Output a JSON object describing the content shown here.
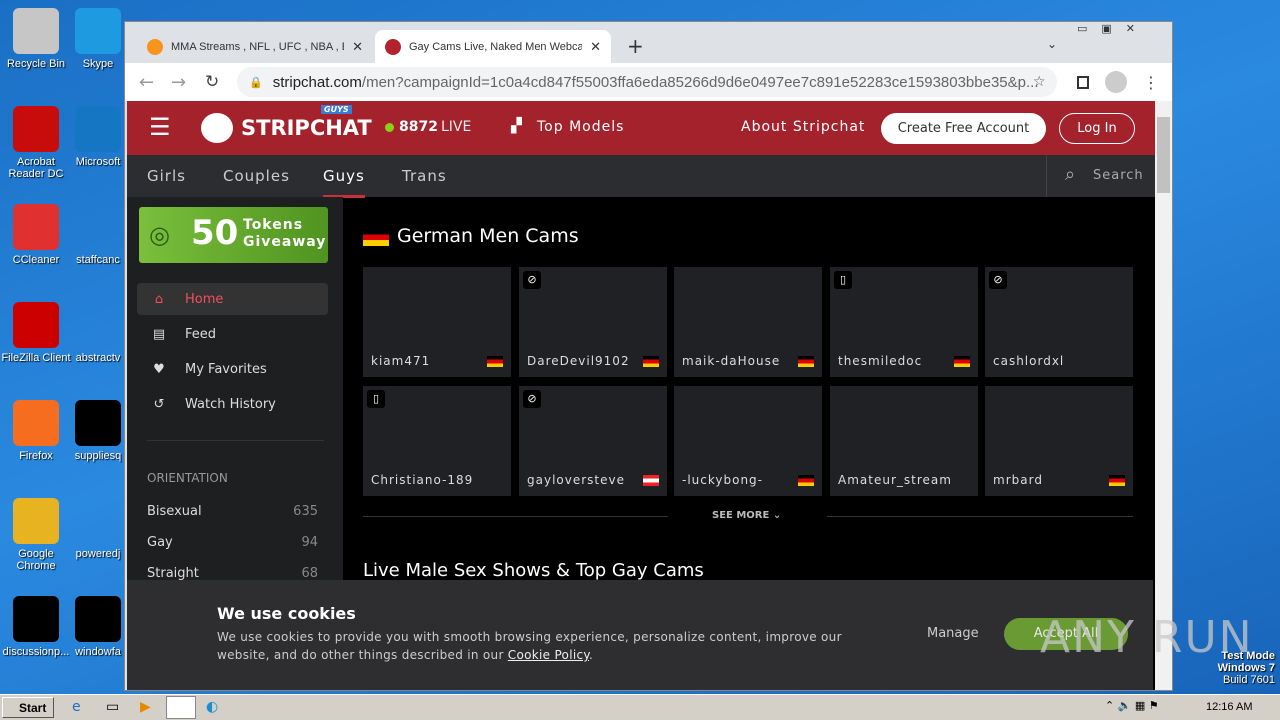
{
  "desktop": {
    "icons": [
      "Recycle Bin",
      "Skype",
      "Acrobat Reader DC",
      "Microsoft",
      "CCleaner",
      "staffcanc",
      "FileZilla Client",
      "abstractv",
      "Firefox",
      "suppliesq",
      "Google Chrome",
      "poweredj",
      "discussionp...",
      "windowfa"
    ],
    "watermark": "ANY RUN",
    "test_mode": [
      "Test Mode",
      "Windows 7",
      "Build 7601"
    ]
  },
  "browser": {
    "tabs": [
      {
        "title": "MMA Streams , NFL , UFC , NBA , Bo"
      },
      {
        "title": "Gay Cams Live, Naked Men Webcam"
      }
    ],
    "url_domain": "stripchat.com",
    "url_path": "/men?campaignId=1c0a4cd847f55003ffa6eda85266d9d6e0497ee7c891e52283ce1593803bbe35&p..."
  },
  "site": {
    "logo": "STRIPCHAT",
    "logo_badge": "GUYS",
    "live_count": "8872",
    "live_label": "LIVE",
    "top_models": "Top Models",
    "about": "About Stripchat",
    "create_account": "Create Free Account",
    "login": "Log In",
    "nav": [
      "Girls",
      "Couples",
      "Guys",
      "Trans"
    ],
    "search_placeholder": "Search",
    "promo": {
      "amount": "50",
      "line1": "Tokens",
      "line2": "Giveaway"
    },
    "sidebar": [
      {
        "label": "Home",
        "icon": "home-icon"
      },
      {
        "label": "Feed",
        "icon": "feed-icon"
      },
      {
        "label": "My Favorites",
        "icon": "heart-icon"
      },
      {
        "label": "Watch History",
        "icon": "history-icon"
      }
    ],
    "orientation_title": "ORIENTATION",
    "orientation": [
      {
        "label": "Bisexual",
        "count": "635"
      },
      {
        "label": "Gay",
        "count": "94"
      },
      {
        "label": "Straight",
        "count": "68"
      }
    ],
    "section_title": "German Men Cams",
    "cams": [
      {
        "name": "kiam471",
        "flag": "de"
      },
      {
        "name": "DareDevil9102",
        "flag": "de",
        "badge": "vr"
      },
      {
        "name": "maik-daHouse",
        "flag": "de"
      },
      {
        "name": "thesmiledoc",
        "flag": "de",
        "badge": "mobile"
      },
      {
        "name": "cashlordxl",
        "flag": "",
        "badge": "vr"
      },
      {
        "name": "Christiano-189",
        "flag": "",
        "badge": "mobile"
      },
      {
        "name": "gayloversteve",
        "flag": "at",
        "badge": "vr"
      },
      {
        "name": "-luckybong-",
        "flag": "de"
      },
      {
        "name": "Amateur_stream",
        "flag": ""
      },
      {
        "name": "mrbard",
        "flag": "de"
      }
    ],
    "see_more": "SEE MORE",
    "section2_title": "Live Male Sex Shows & Top Gay Cams",
    "cookie": {
      "title": "We use cookies",
      "text": "We use cookies to provide you with smooth browsing experience, personalize content, improve our website, and do other things described in our ",
      "link": "Cookie Policy",
      "manage": "Manage",
      "accept": "Accept All"
    }
  },
  "taskbar": {
    "start": "Start",
    "clock": "12:16 AM"
  },
  "colors": {
    "brand": "#a3222c",
    "accent_green": "#6a9a34",
    "live_dot": "#8bd014"
  }
}
